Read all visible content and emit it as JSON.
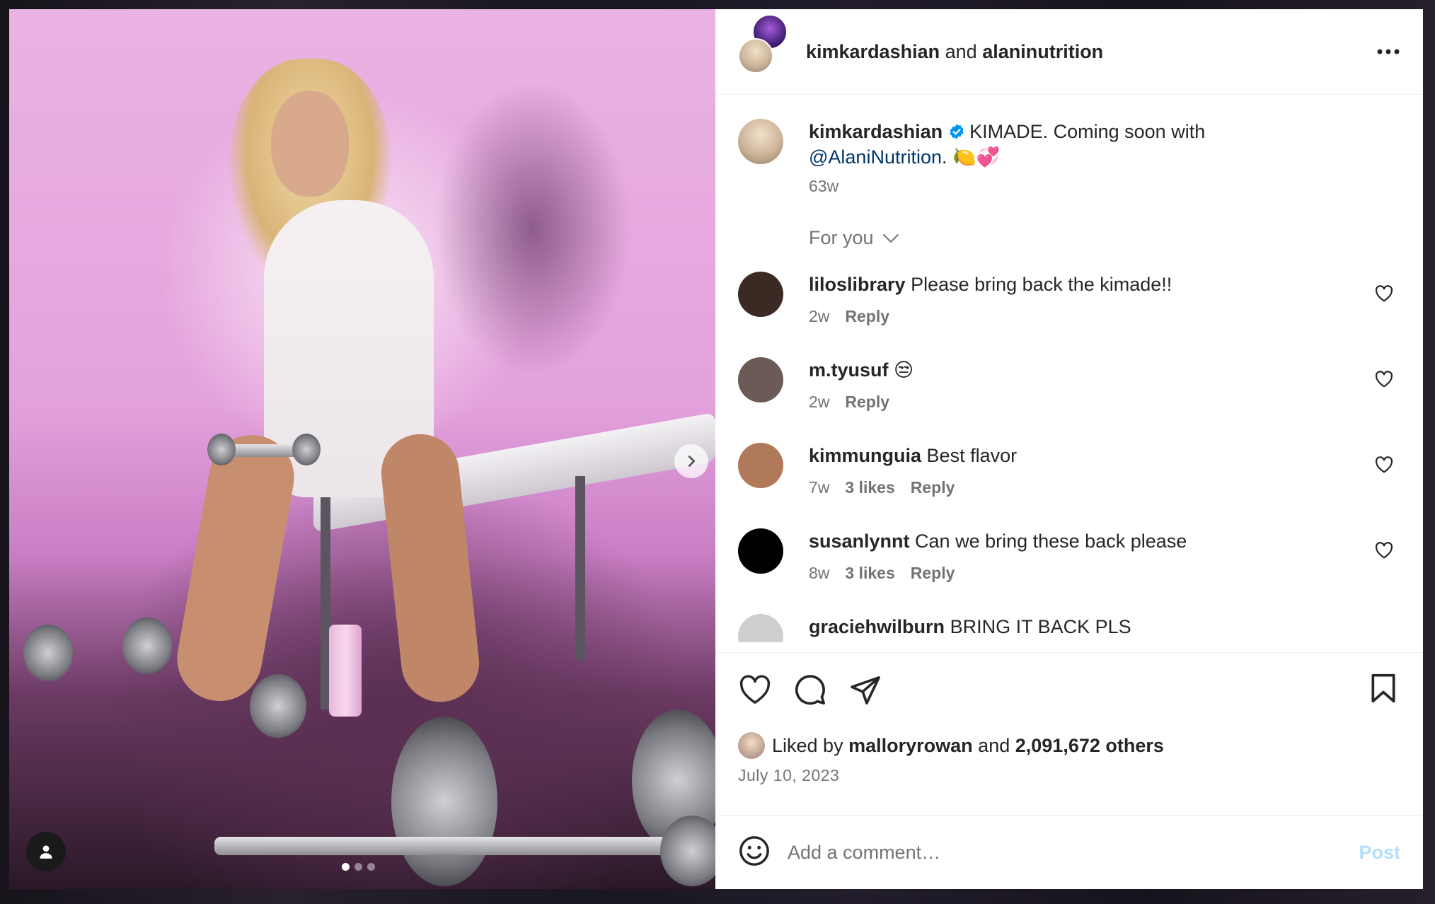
{
  "header": {
    "user1": "kimkardashian",
    "and": "and",
    "user2": "alaninutrition"
  },
  "caption": {
    "username": "kimkardashian",
    "text": "KIMADE. Coming soon with",
    "mention": "@AlaniNutrition",
    "suffix": ". 🍋💞",
    "time": "63w"
  },
  "filter_label": "For you",
  "comments": [
    {
      "username": "liloslibrary",
      "text": "Please bring back the kimade!!",
      "time": "2w",
      "likes": "",
      "reply": "Reply",
      "avatar_color": "#3b2a24"
    },
    {
      "username": "m.tyusuf",
      "text": "😒",
      "time": "2w",
      "likes": "",
      "reply": "Reply",
      "avatar_color": "#6b5a55"
    },
    {
      "username": "kimmunguia",
      "text": "Best flavor",
      "time": "7w",
      "likes": "3 likes",
      "reply": "Reply",
      "avatar_color": "#b07a5a"
    },
    {
      "username": "susanlynnt",
      "text": "Can we bring these back please",
      "time": "8w",
      "likes": "3 likes",
      "reply": "Reply",
      "avatar_color": "#000000"
    },
    {
      "username": "graciehwilburn",
      "text": "BRING IT BACK PLS",
      "time": "",
      "likes": "",
      "reply": "",
      "avatar_color": "#cfcfcf"
    }
  ],
  "likes": {
    "prefix": "Liked by",
    "user": "malloryrowan",
    "mid": "and",
    "count": "2,091,672 others"
  },
  "date": "July 10, 2023",
  "add_comment": {
    "placeholder": "Add a comment…",
    "post_label": "Post"
  },
  "colors": {
    "verified": "#0095f6",
    "mention": "#00376b",
    "muted": "#737373",
    "post_disabled": "#b2dffc"
  },
  "icons": [
    "more-icon",
    "verified-icon",
    "chevron-down-icon",
    "heart-icon",
    "comment-icon",
    "share-icon",
    "bookmark-icon",
    "emoji-icon",
    "user-tag-icon",
    "chevron-right-icon"
  ]
}
